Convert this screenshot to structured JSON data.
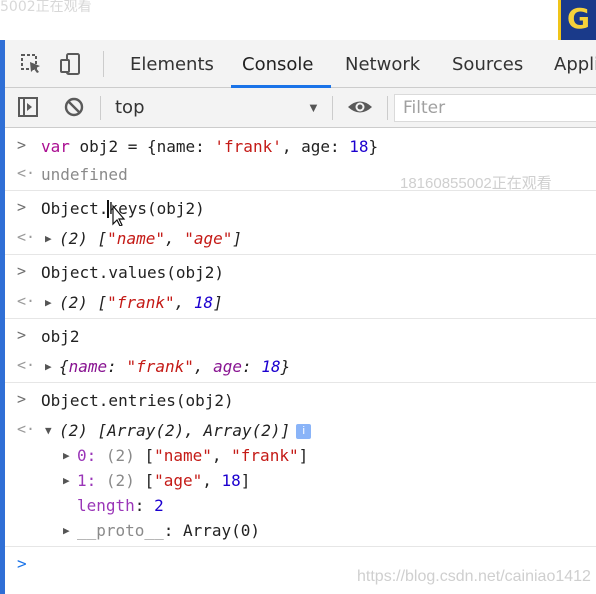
{
  "overlay": {
    "top_ghost_text": "5002正在观看",
    "watermark_top": "18160855002正在观看",
    "watermark_bottom": "https://blog.csdn.net/cainiao1412",
    "badge_letter": "G"
  },
  "tabs": [
    {
      "label": "Elements"
    },
    {
      "label": "Console",
      "active": true
    },
    {
      "label": "Network"
    },
    {
      "label": "Sources"
    },
    {
      "label": "Appli"
    }
  ],
  "toolbar": {
    "context_value": "top",
    "filter_placeholder": "Filter"
  },
  "console": {
    "cmd1": {
      "prefix": "var",
      "text": " obj2 = {name: ",
      "str": "'frank'",
      "mid": ", age: ",
      "num": "18",
      "end": "}"
    },
    "res1": "undefined",
    "cmd2": "Object.keys(obj2)",
    "res2": {
      "count": "(2)",
      "a": "\"name\"",
      "b": "\"age\""
    },
    "cmd3": "Object.values(obj2)",
    "res3": {
      "count": "(2)",
      "a": "\"frank\"",
      "b": "18"
    },
    "cmd4": "obj2",
    "res4": {
      "k1": "name",
      "v1": "\"frank\"",
      "k2": "age",
      "v2": "18"
    },
    "cmd5": "Object.entries(obj2)",
    "res5": {
      "header": "(2) [Array(2), Array(2)]",
      "item0": {
        "key": "0",
        "count": "(2)",
        "a": "\"name\"",
        "b": "\"frank\""
      },
      "item1": {
        "key": "1",
        "count": "(2)",
        "a": "\"age\"",
        "b": "18"
      },
      "length_key": "length",
      "length_val": "2",
      "proto_key": "__proto__",
      "proto_val": "Array(0)"
    }
  }
}
